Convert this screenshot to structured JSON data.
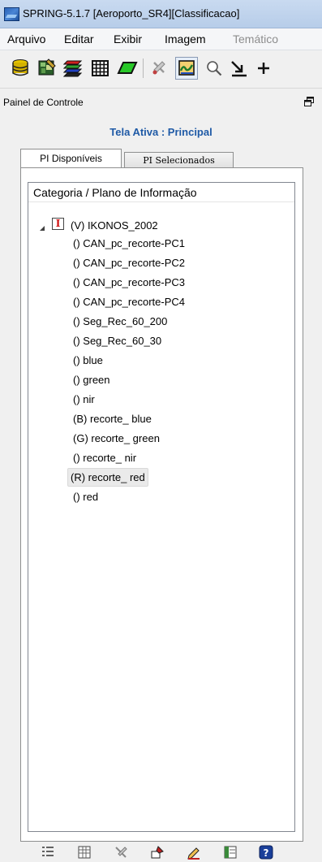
{
  "window": {
    "title": "SPRING-5.1.7 [Aeroporto_SR4][Classificacao]",
    "app_icon": "spring-app-icon"
  },
  "menu": {
    "items": [
      {
        "label": "Arquivo",
        "enabled": true
      },
      {
        "label": "Editar",
        "enabled": true
      },
      {
        "label": "Exibir",
        "enabled": true
      },
      {
        "label": "Imagem",
        "enabled": true
      },
      {
        "label": "Temático",
        "enabled": false
      }
    ]
  },
  "toolbar": {
    "buttons": [
      {
        "icon": "database-icon"
      },
      {
        "icon": "image-composite-icon"
      },
      {
        "icon": "layers-icon"
      },
      {
        "icon": "grid-icon"
      },
      {
        "icon": "polygon-icon"
      },
      {
        "icon": "tools-icon"
      },
      {
        "icon": "activate-display-icon",
        "pressed": true
      },
      {
        "icon": "zoom-icon"
      },
      {
        "icon": "zoom-area-icon"
      },
      {
        "icon": "cursor-cross-icon"
      }
    ]
  },
  "panel": {
    "title": "Painel de Controle",
    "active_screen": "Tela Ativa : Principal",
    "tabs": [
      {
        "label": "PI Disponíveis",
        "active": true
      },
      {
        "label": "PI Selecionados",
        "active": false
      }
    ],
    "tree": {
      "header": "Categoria / Plano de Informação",
      "category": {
        "label": "(V) IKONOS_2002",
        "icon_letter": "I",
        "expanded": true
      },
      "items": [
        {
          "label": "() CAN_pc_recorte-PC1"
        },
        {
          "label": "() CAN_pc_recorte-PC2"
        },
        {
          "label": "() CAN_pc_recorte-PC3"
        },
        {
          "label": "() CAN_pc_recorte-PC4"
        },
        {
          "label": "() Seg_Rec_60_200"
        },
        {
          "label": "() Seg_Rec_60_30"
        },
        {
          "label": "() blue"
        },
        {
          "label": "() green"
        },
        {
          "label": "() nir"
        },
        {
          "label": "(B) recorte_ blue"
        },
        {
          "label": "(G) recorte_ green"
        },
        {
          "label": "() recorte_ nir"
        },
        {
          "label": "(R) recorte_ red",
          "selected": true
        },
        {
          "label": "() red"
        }
      ]
    }
  },
  "bottom_toolbar": {
    "buttons": [
      {
        "icon": "list-icon"
      },
      {
        "icon": "table-icon"
      },
      {
        "icon": "tools-icon"
      },
      {
        "icon": "paint-icon"
      },
      {
        "icon": "edit-icon"
      },
      {
        "icon": "panel-icon"
      },
      {
        "icon": "help-icon"
      }
    ]
  },
  "colors": {
    "active_screen_title": "#1f5aa6",
    "category_icon_letter": "#d01010",
    "menu_disabled": "#8d8d8d"
  }
}
